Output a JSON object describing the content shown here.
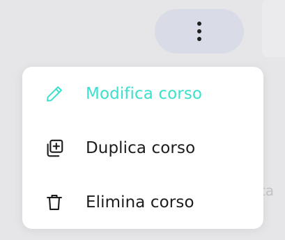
{
  "background": {
    "partial_text": "ta"
  },
  "more_button": {
    "icon": "more-vertical-icon"
  },
  "menu": {
    "items": [
      {
        "label": "Modifica corso",
        "icon": "pencil-icon",
        "color": "#3ddfcd",
        "active": true
      },
      {
        "label": "Duplica corso",
        "icon": "duplicate-icon",
        "color": "#1c1c1c",
        "active": false
      },
      {
        "label": "Elimina corso",
        "icon": "trash-icon",
        "color": "#1c1c1c",
        "active": false
      }
    ]
  },
  "colors": {
    "accent": "#3ddfcd",
    "text": "#1c1c1c",
    "button_bg": "#d9dbe6",
    "menu_bg": "#ffffff",
    "page_bg": "#e6e6e8"
  }
}
